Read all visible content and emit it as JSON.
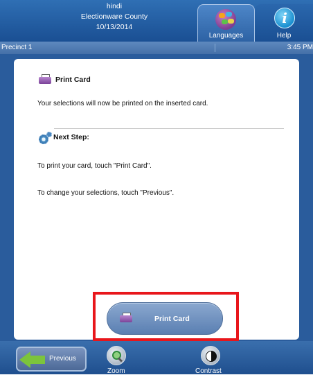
{
  "header": {
    "language_line": "hindi",
    "county": "Electionware County",
    "date": "10/13/2014",
    "tabs": {
      "languages": "Languages",
      "help": "Help"
    }
  },
  "status_bar": {
    "precinct": "Precinct 1",
    "time": "3:45 PM"
  },
  "card": {
    "section_title": "Print Card",
    "section_text": "Your selections will now be printed on the inserted card.",
    "next_step_title": "Next Step:",
    "instruction_print": "To print your card, touch \"Print Card\".",
    "instruction_change": "To change your selections, touch \"Previous\"."
  },
  "print_button": {
    "label": "Print Card"
  },
  "footer": {
    "previous": "Previous",
    "zoom": "Zoom",
    "contrast": "Contrast"
  },
  "colors": {
    "highlight": "#e8161b",
    "header_blue": "#1a4f93",
    "previous_arrow": "#7cc43c"
  },
  "icons": {
    "languages": "globe-icon",
    "help": "info-icon",
    "print": "printer-icon",
    "next_step": "gears-icon",
    "previous": "arrow-left-icon",
    "zoom": "magnifier-icon",
    "contrast": "contrast-icon"
  }
}
